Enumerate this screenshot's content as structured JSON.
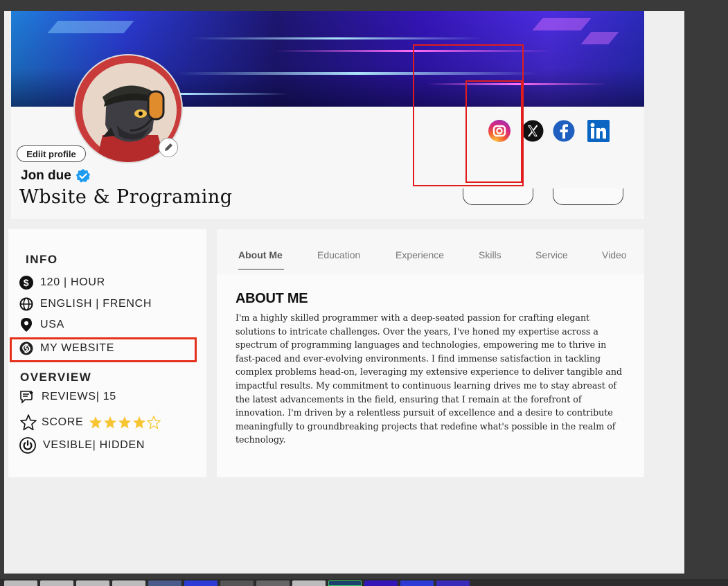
{
  "profile": {
    "edit_label": "Ediit profile",
    "name": "Jon due",
    "title": "Wbsite & Programing"
  },
  "social": [
    "instagram-icon",
    "x-icon",
    "facebook-icon",
    "linkedin-icon"
  ],
  "info": {
    "title": "INFO",
    "rate": "120 | HOUR",
    "languages": "ENGLISH | FRENCH",
    "location": "USA",
    "website": "MY WEBSITE"
  },
  "overview": {
    "title": "OVERVIEW",
    "reviews": "REVIEWS| 15",
    "score_label": "SCORE",
    "score_stars": 4,
    "score_max": 5,
    "visibility": "VESIBLE| HIDDEN"
  },
  "tabs": [
    "About Me",
    "Education",
    "Experience",
    "Skills",
    "Service",
    "Video"
  ],
  "about": {
    "title": "ABOUT ME",
    "text": "I'm a highly skilled programmer with a deep-seated passion for crafting elegant solutions to intricate challenges. Over the years, I've honed my expertise across a spectrum of programming languages and technologies, empowering me to thrive in fast-paced and ever-evolving environments. I find immense satisfaction in tackling complex problems head-on, leveraging my extensive experience to deliver tangible and impactful results. My commitment to continuous learning drives me to stay abreast of the latest advancements in the field, ensuring that I remain at the forefront of innovation. I'm driven by a relentless pursuit of excellence and a desire to contribute meaningfully to groundbreaking projects that redefine what's possible in the realm of technology."
  },
  "colors": {
    "accent_red": "#e11c1c",
    "verified_blue": "#1d9bf0",
    "star_yellow": "#f7c531"
  }
}
